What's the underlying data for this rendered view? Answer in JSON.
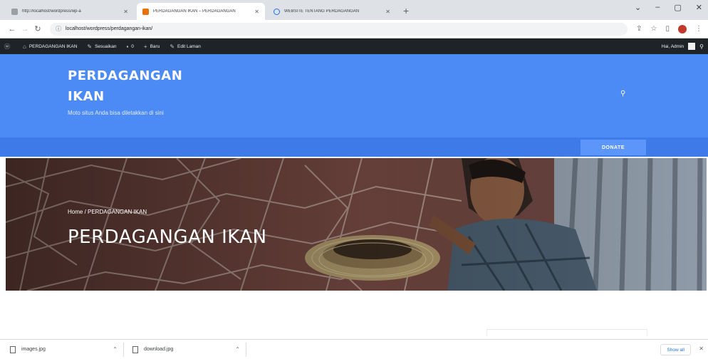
{
  "browser": {
    "tabs": [
      {
        "title": "http://localhost/wordpress/wp-a",
        "color": "#5f6368"
      },
      {
        "title": "PERDAGANGAN IKAN – PERDAGANGAN",
        "color": "#e8710a"
      },
      {
        "title": "WEBSITE TENTANG PERDAGANGAN",
        "color": "#1a73e8"
      }
    ],
    "new_tab": "+",
    "url": "localhost/wordpress/perdagangan-ikan/",
    "window_controls": [
      "⌄",
      "–",
      "▢",
      "✕"
    ]
  },
  "adminbar": {
    "site_name": "PERDAGANGAN IKAN",
    "customize": "Sesuaikan",
    "comments_count": "0",
    "new": "Baru",
    "edit_page": "Edit Laman",
    "greeting": "Hai, Admin"
  },
  "header": {
    "site_title": "PERDAGANGAN IKAN",
    "tagline": "Moto situs Anda bisa diletakkan di sini",
    "bg_color": "#4c8af5"
  },
  "nav": {
    "donate_label": "DONATE"
  },
  "hero": {
    "breadcrumb": "Home / PERDAGANGAN IKAN",
    "title": "PERDAGANGAN IKAN"
  },
  "downloads": {
    "items": [
      {
        "name": "images.jpg"
      },
      {
        "name": "download.jpg"
      }
    ],
    "show_all": "Show all"
  }
}
